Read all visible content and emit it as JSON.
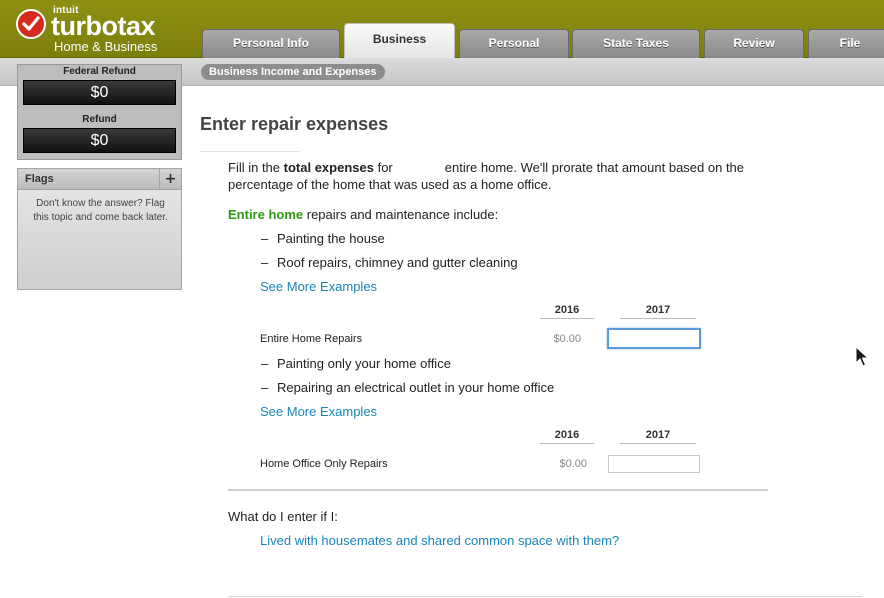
{
  "app": {
    "logo_intuit": "intuit",
    "logo_brand": "turbotax",
    "logo_edition": "Home & Business"
  },
  "tabs": [
    {
      "label": "Personal Info",
      "active": false
    },
    {
      "label": "Business",
      "active": true
    },
    {
      "label": "Personal",
      "active": false
    },
    {
      "label": "State Taxes",
      "active": false
    },
    {
      "label": "Review",
      "active": false
    },
    {
      "label": "File",
      "active": false
    }
  ],
  "subnav": {
    "breadcrumb": "Business Income and Expenses"
  },
  "sidebar": {
    "federal_refund_label": "Federal Refund",
    "federal_refund_value": "$0",
    "refund_label": "Refund",
    "refund_value": "$0",
    "flags_title": "Flags",
    "flags_add": "+",
    "flags_text": "Don't know the answer? Flag this topic and come back later."
  },
  "main": {
    "title": "Enter repair expenses",
    "intro_part1": "Fill in the ",
    "intro_bold": "total expenses",
    "intro_part2": " for",
    "intro_part3": "entire home. We'll prorate that amount based on the percentage of the home that was used as a home office.",
    "entire_home_lead_green": "Entire home",
    "entire_home_lead_rest": " repairs and maintenance include:",
    "entire_home_bullets": [
      "Painting the house",
      "Roof repairs, chimney and gutter cleaning"
    ],
    "see_more_1": "See More Examples",
    "years": {
      "prior": "2016",
      "current": "2017"
    },
    "entire_home_row": {
      "label": "Entire Home Repairs",
      "prior_value": "$0.00",
      "current_value": ""
    },
    "home_office_bullets": [
      "Painting only your home office",
      "Repairing an electrical outlet in your home office"
    ],
    "see_more_2": "See More Examples",
    "home_office_row": {
      "label": "Home Office Only Repairs",
      "prior_value": "$0.00",
      "current_value": ""
    },
    "question_label": "What do I enter if I:",
    "question_link": "Lived with housemates and shared common space with them?"
  },
  "colors": {
    "header_olive": "#8e8f12",
    "link_blue": "#1a86b8",
    "green_emphasis": "#2f9a12",
    "logo_red": "#d52b1e"
  }
}
